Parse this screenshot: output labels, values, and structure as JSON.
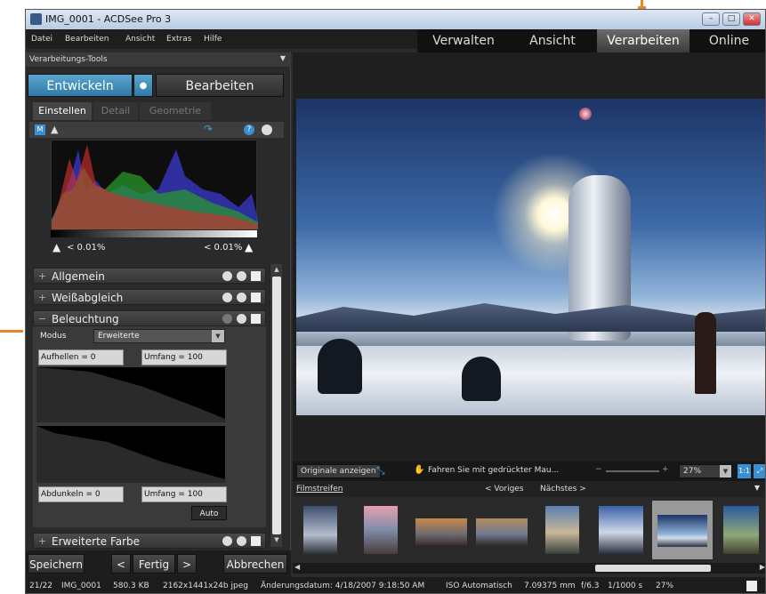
{
  "window": {
    "title": "IMG_0001 - ACDSee Pro 3"
  },
  "menu": [
    "Datei",
    "Bearbeiten",
    "Ansicht",
    "Extras",
    "Hilfe"
  ],
  "mode_tabs": [
    "Verwalten",
    "Ansicht",
    "Verarbeiten",
    "Online"
  ],
  "left_panel": {
    "header": "Verarbeitungs-Tools",
    "develop_label": "Entwickeln",
    "edit_label": "Bearbeiten",
    "subtabs": [
      "Einstellen",
      "Detail",
      "Geometrie"
    ],
    "clip_left": "< 0.01%",
    "clip_right": "< 0.01%",
    "sections": [
      "Allgemein",
      "Weißabgleich",
      "Beleuchtung"
    ],
    "last_section": "Erweiterte Farbe",
    "modus_label": "Modus",
    "modus_value": "Erweiterte",
    "brighten": "Aufhellen = 0",
    "range_top": "Umfang = 100",
    "darken": "Abdunkeln = 0",
    "range_bottom": "Umfang = 100",
    "auto": "Auto"
  },
  "bottom_buttons": {
    "save": "Speichern",
    "prev": "<",
    "done": "Fertig",
    "next": ">",
    "cancel": "Abbrechen"
  },
  "viewer_toolbar": {
    "show_original": "Originale anzeigen",
    "pan_hint": "Fahren Sie mit gedrückter Mau...",
    "zoom": "27%",
    "one_to_one": "1:1"
  },
  "filmstrip": {
    "label": "Filmstreifen",
    "prev": "< Voriges",
    "next": "Nächstes >",
    "thumb_count": 8,
    "selected_index": 6
  },
  "status": {
    "position": "21/22",
    "file": "IMG_0001",
    "size": "580.3 KB",
    "dimensions": "2162x1441x24b jpeg",
    "modified": "Änderungsdatum: 4/18/2007 9:18:50 AM",
    "iso": "ISO Automatisch",
    "focal": "7.09375 mm",
    "aperture": "f/6.3",
    "shutter": "1/1000 s",
    "zoom": "27%"
  },
  "colors": {
    "accent": "#4a9fd0",
    "callout": "#e8862a"
  }
}
